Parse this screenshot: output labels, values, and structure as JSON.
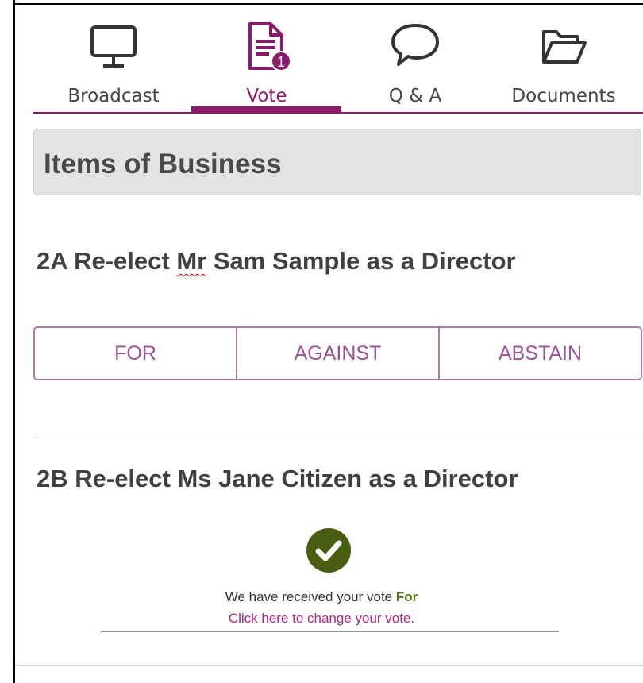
{
  "tabs": [
    {
      "label": "Broadcast",
      "icon": "monitor-icon",
      "active": false
    },
    {
      "label": "Vote",
      "icon": "document-icon",
      "active": true,
      "badge": "1"
    },
    {
      "label": "Q & A",
      "icon": "speech-bubble-icon",
      "active": false
    },
    {
      "label": "Documents",
      "icon": "folder-open-icon",
      "active": false
    }
  ],
  "header": {
    "title": "Items of Business"
  },
  "items": [
    {
      "title_prefix": "2A Re-elect ",
      "title_flagged": "Mr",
      "title_suffix": " Sam Sample as a Director",
      "options": [
        "FOR",
        "AGAINST",
        "ABSTAIN"
      ]
    },
    {
      "title": "2B Re-elect Ms Jane Citizen as a Director",
      "confirmation": {
        "text": "We have received your vote",
        "choice": "For",
        "change_link": "Click here to change your vote."
      }
    }
  ],
  "colors": {
    "accent": "#8a1a6a",
    "button_text": "#9b5392",
    "check": "#4a5e12",
    "vote_choice": "#4f7a18",
    "link": "#b0277f"
  }
}
